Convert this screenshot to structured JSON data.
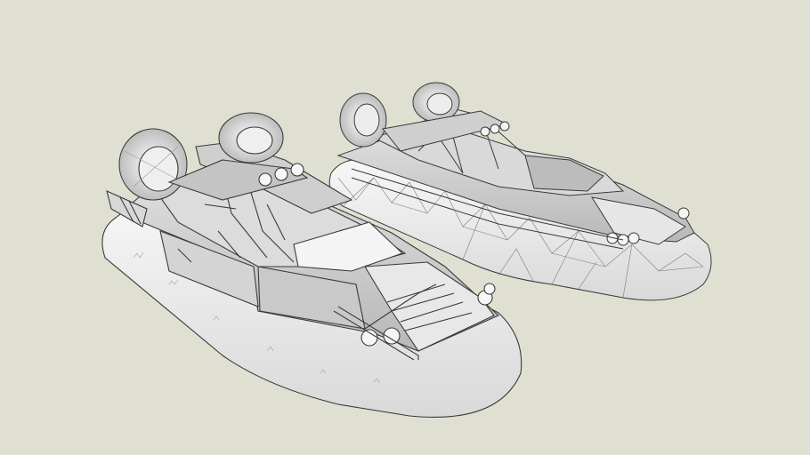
{
  "scene": {
    "background_color": "#e0e0d2",
    "line_color": "#3a3a3a",
    "skirt_color": "#f2f2f2",
    "hull_color": "#cfcfcf",
    "panel_color": "#e6e6e6",
    "objects": [
      {
        "name": "hovercraft-front",
        "style": "shaded-sketch"
      },
      {
        "name": "hovercraft-back",
        "style": "wireframe-sketch"
      }
    ]
  }
}
